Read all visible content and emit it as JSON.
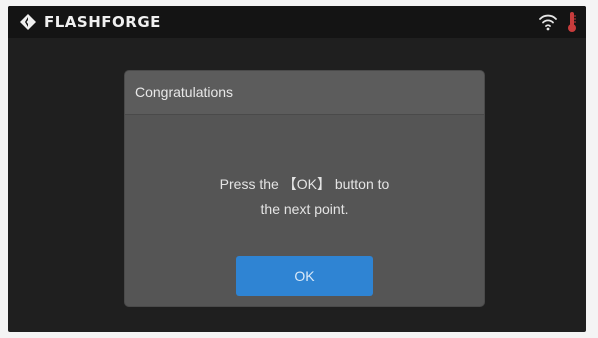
{
  "header": {
    "brand": "FLASHFORGE",
    "logo_icon": "flashforge-logo-icon",
    "wifi_icon": "wifi-icon",
    "temperature_icon": "thermometer-icon",
    "temperature_color": "#c83c3c"
  },
  "dialog": {
    "title": "Congratulations",
    "message_line1": "Press the 【OK】 button to",
    "message_line2": "the next point.",
    "ok_label": "OK",
    "ok_color": "#2f84d3"
  }
}
